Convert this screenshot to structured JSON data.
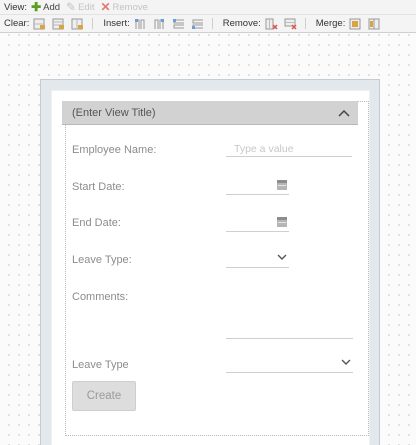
{
  "toolbar_view": {
    "label": "View:",
    "add": "Add",
    "edit": "Edit",
    "remove": "Remove"
  },
  "toolbar_layout": {
    "clear_label": "Clear:",
    "insert_label": "Insert:",
    "remove_label": "Remove:",
    "merge_label": "Merge:"
  },
  "view": {
    "title": "(Enter View Title)",
    "fields": {
      "employee_name": {
        "label": "Employee Name:",
        "placeholder": "Type a value"
      },
      "start_date": {
        "label": "Start Date:"
      },
      "end_date": {
        "label": "End Date:"
      },
      "leave_type": {
        "label": "Leave Type:"
      },
      "comments": {
        "label": "Comments:"
      },
      "leave_type_2": {
        "label": "Leave Type"
      }
    },
    "create_button": "Create"
  },
  "colors": {
    "add_icon": "#5a9e1f",
    "remove_icon": "#d9534f",
    "header_bg": "#d2d2d2"
  }
}
